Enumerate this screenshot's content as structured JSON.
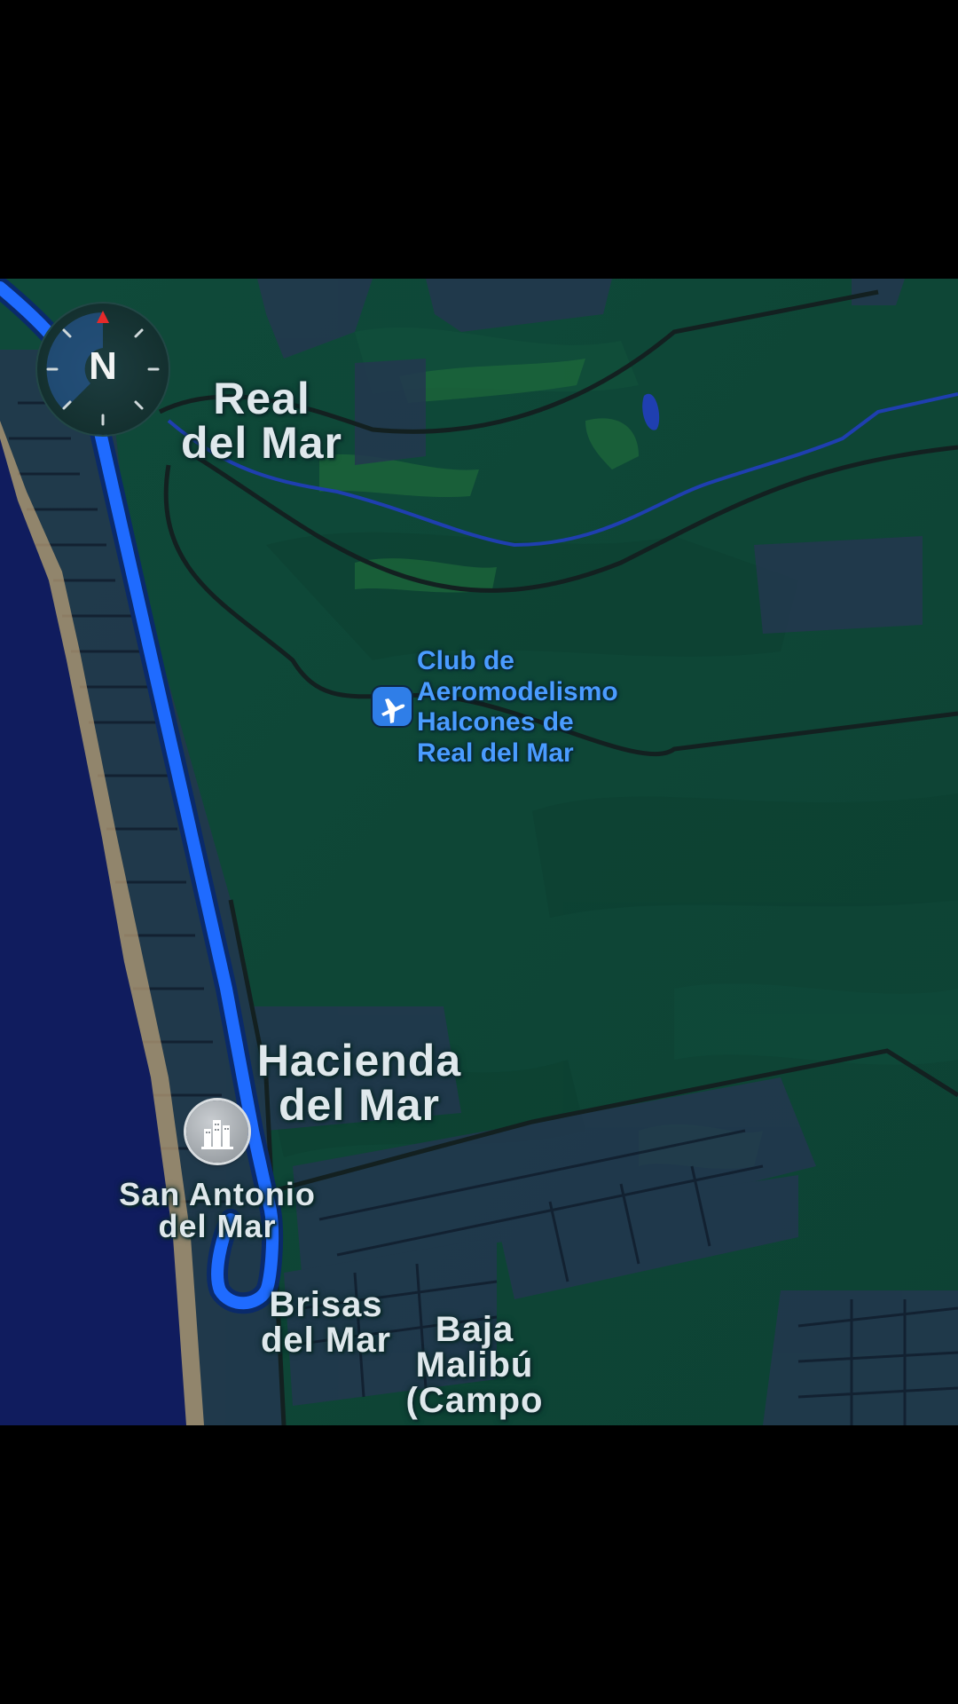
{
  "compass": {
    "heading_letter": "N",
    "icon": "compass-icon"
  },
  "places": {
    "real_del_mar": "Real\ndel Mar",
    "hacienda_del_mar": "Hacienda\ndel Mar",
    "san_antonio_del_mar": "San Antonio\ndel Mar",
    "brisas_del_mar": "Brisas\ndel Mar",
    "baja_malibu": "Baja\nMalibú\n(Campo"
  },
  "poi": {
    "name": "Club de\nAeromodelismo\nHalcones de\nReal del Mar",
    "icon": "airplane-icon"
  },
  "city_marker": {
    "icon": "city-buildings-icon"
  },
  "colors": {
    "ocean": "#101c5e",
    "land": "#0f4a3a",
    "route": "#1f6bff",
    "poi_text": "#4a9cff"
  }
}
